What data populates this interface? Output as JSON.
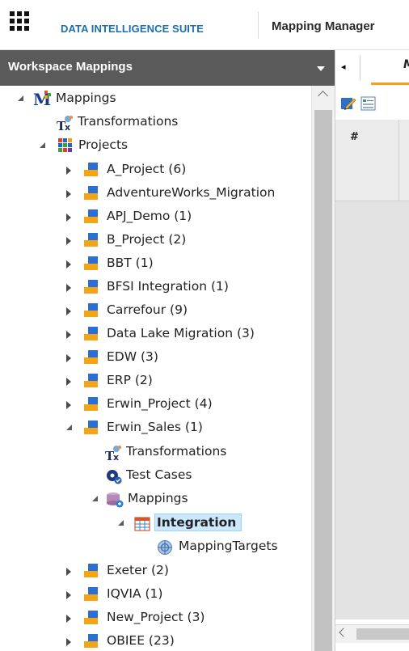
{
  "header": {
    "brand": "DATA INTELLIGENCE SUITE",
    "app_title": "Mapping Manager"
  },
  "panel": {
    "title": "Workspace Mappings"
  },
  "tree": {
    "root": "Mappings",
    "transformations": "Transformations",
    "projects": "Projects",
    "project_items": [
      "A_Project (6)",
      "AdventureWorks_Migration",
      "APJ_Demo (1)",
      "B_Project (2)",
      "BBT (1)",
      "BFSI Integration (1)",
      "Carrefour (9)",
      "Data Lake Migration (3)",
      "EDW (3)",
      "ERP (2)",
      "Erwin_Project (4)"
    ],
    "expanded_project": {
      "label": "Erwin_Sales (1)",
      "transformations": "Transformations",
      "test_cases": "Test Cases",
      "mappings": "Mappings",
      "selected_mapping": "Integration",
      "mapping_targets": "MappingTargets"
    },
    "more_projects": [
      "Exeter (2)",
      "IQVIA (1)",
      "New_Project (3)",
      "OBIEE (23)"
    ]
  },
  "right_panel": {
    "tab_label": "M",
    "tab_left_arrow": "◂",
    "column_header": "#"
  },
  "colors": {
    "brand": "#1a6fb0",
    "panel_header": "#5a5a5a",
    "selection": "#cce8ff",
    "active_tab": "#f0a21c"
  }
}
